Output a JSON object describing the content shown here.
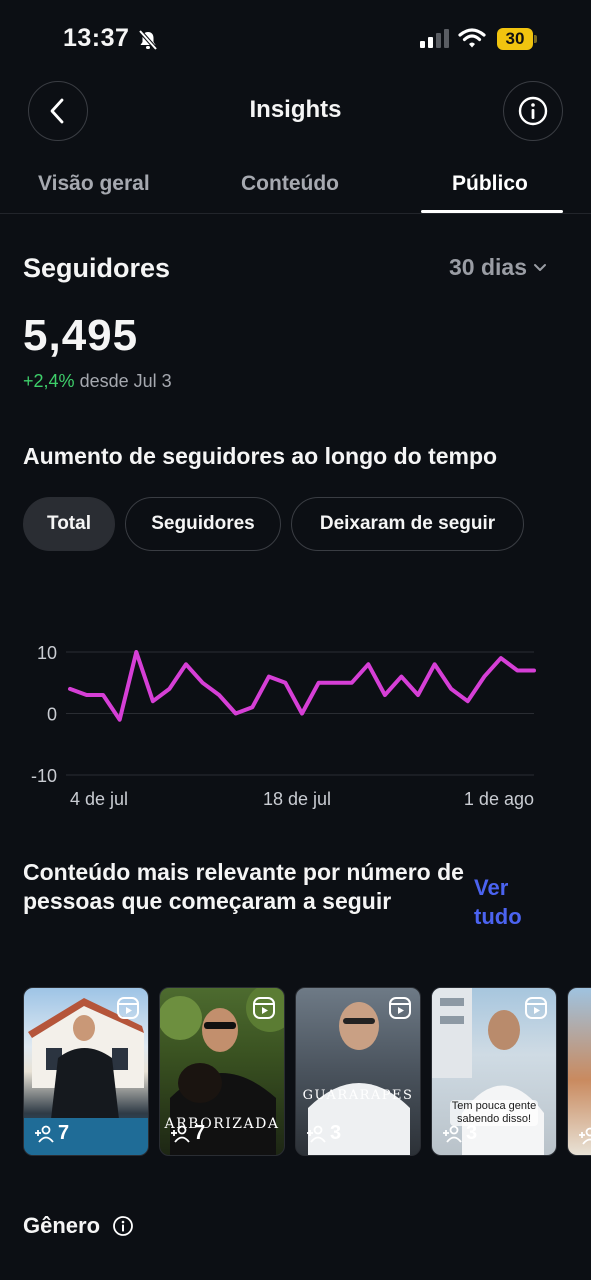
{
  "status_bar": {
    "time": "13:37",
    "battery": "30"
  },
  "header": {
    "title": "Insights"
  },
  "tabs": [
    {
      "label": "Visão geral",
      "active": false
    },
    {
      "label": "Conteúdo",
      "active": false
    },
    {
      "label": "Público",
      "active": true
    }
  ],
  "followers": {
    "title": "Seguidores",
    "period": "30 dias",
    "count": "5,495",
    "growth": "+2,4%",
    "growth_since": "desde Jul 3"
  },
  "growth_section": {
    "title": "Aumento de seguidores ao longo do tempo",
    "chips": [
      {
        "label": "Total",
        "active": true
      },
      {
        "label": "Seguidores",
        "active": false
      },
      {
        "label": "Deixaram de seguir",
        "active": false
      }
    ]
  },
  "chart_data": {
    "type": "line",
    "color": "#d63fd6",
    "y_ticks": [
      "10",
      "0",
      "-10"
    ],
    "ylim": [
      -10,
      10
    ],
    "x_tick_labels": [
      "4 de jul",
      "18 de jul",
      "1 de ago"
    ],
    "series": [
      {
        "values": [
          4,
          3,
          3,
          -1,
          10,
          2,
          4,
          8,
          5,
          3,
          0,
          1,
          6,
          5,
          0,
          5,
          5,
          5,
          8,
          3,
          6,
          3,
          8,
          4,
          2,
          6,
          9,
          7,
          7
        ]
      }
    ]
  },
  "top_content": {
    "title": "Conteúdo mais relevante por número de pessoas que começaram a seguir",
    "see_all": "Ver tudo",
    "items": [
      {
        "count": "7",
        "overlay": ""
      },
      {
        "count": "7",
        "overlay": "ARBORIZADA"
      },
      {
        "count": "3",
        "overlay": "GUARARAPES"
      },
      {
        "count": "3",
        "overlay": "Tem pouca gente sabendo disso!"
      }
    ]
  },
  "gender": {
    "title": "Gênero"
  }
}
